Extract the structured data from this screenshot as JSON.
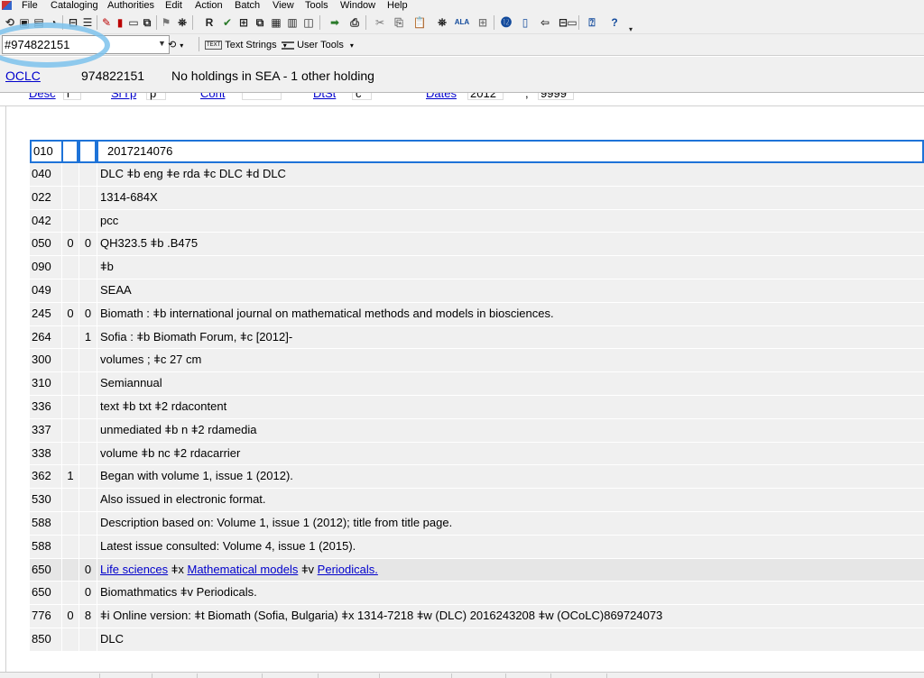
{
  "menubar": {
    "items": [
      "File",
      "Cataloging",
      "Authorities",
      "Edit",
      "Action",
      "Batch",
      "View",
      "Tools",
      "Window",
      "Help"
    ]
  },
  "toolbar": {
    "search_value": "#974822151",
    "text_strings_label": "Text Strings",
    "user_tools_label": "User Tools",
    "text_icon_label": "TEXT",
    "r_icon_label": "R",
    "ala_icon_label": "ALA",
    "help_icon_label": "?"
  },
  "status": {
    "ocl_label": "OCLC",
    "ocl_number": "974822151",
    "holdings": "No holdings in SEA - 1 other holding"
  },
  "fixed_fields": {
    "desc_label": "Desc",
    "desc_value": "i",
    "srtp_label": "SrTp",
    "srtp_value": "p",
    "cont_label": "Cont",
    "dtst_label": "DtSt",
    "dtst_value": "c",
    "dates_label": "Dates",
    "date1": "2012",
    "sep": ",",
    "date2": "9999"
  },
  "record": {
    "rows": [
      {
        "tag": "010",
        "ind1": "",
        "ind2": "",
        "content": "2017214076"
      },
      {
        "tag": "040",
        "ind1": "",
        "ind2": "",
        "content": "DLC ǂb eng ǂe rda ǂc DLC ǂd DLC"
      },
      {
        "tag": "022",
        "ind1": "",
        "ind2": "",
        "content": "1314-684X"
      },
      {
        "tag": "042",
        "ind1": "",
        "ind2": "",
        "content": "pcc"
      },
      {
        "tag": "050",
        "ind1": "0",
        "ind2": "0",
        "content": "QH323.5 ǂb .B475"
      },
      {
        "tag": "090",
        "ind1": "",
        "ind2": "",
        "content": "ǂb"
      },
      {
        "tag": "049",
        "ind1": "",
        "ind2": "",
        "content": "SEAA"
      },
      {
        "tag": "245",
        "ind1": "0",
        "ind2": "0",
        "content": "Biomath : ǂb international journal on mathematical methods and models in biosciences."
      },
      {
        "tag": "264",
        "ind1": "",
        "ind2": "1",
        "content": "Sofia : ǂb Biomath Forum, ǂc [2012]-"
      },
      {
        "tag": "300",
        "ind1": "",
        "ind2": "",
        "content": "volumes ; ǂc 27 cm"
      },
      {
        "tag": "310",
        "ind1": "",
        "ind2": "",
        "content": "Semiannual"
      },
      {
        "tag": "336",
        "ind1": "",
        "ind2": "",
        "content": "text ǂb txt ǂ2 rdacontent"
      },
      {
        "tag": "337",
        "ind1": "",
        "ind2": "",
        "content": "unmediated ǂb n ǂ2 rdamedia"
      },
      {
        "tag": "338",
        "ind1": "",
        "ind2": "",
        "content": "volume ǂb nc ǂ2 rdacarrier"
      },
      {
        "tag": "362",
        "ind1": "1",
        "ind2": "",
        "content": "Began with volume 1, issue 1 (2012)."
      },
      {
        "tag": "530",
        "ind1": "",
        "ind2": "",
        "content": "Also issued in electronic format."
      },
      {
        "tag": "588",
        "ind1": "",
        "ind2": "",
        "content": "Description based on: Volume 1, issue 1 (2012); title from title page."
      },
      {
        "tag": "588",
        "ind1": "",
        "ind2": "",
        "content": "Latest issue consulted: Volume 4, issue 1 (2015)."
      },
      {
        "tag": "650",
        "ind1": "",
        "ind2": "0",
        "content": "",
        "linked": {
          "a": "Life sciences",
          "x_sep": "ǂx",
          "x": "Mathematical models",
          "v_sep": "ǂv",
          "v": "Periodicals."
        }
      },
      {
        "tag": "650",
        "ind1": "",
        "ind2": "0",
        "content": "Biomathmatics ǂv Periodicals."
      },
      {
        "tag": "776",
        "ind1": "0",
        "ind2": "8",
        "content": "ǂi Online version: ǂt Biomath (Sofia, Bulgaria) ǂx 1314-7218 ǂw (DLC)  2016243208 ǂw (OCoLC)869724073"
      },
      {
        "tag": "850",
        "ind1": "",
        "ind2": "",
        "content": "DLC"
      }
    ]
  }
}
